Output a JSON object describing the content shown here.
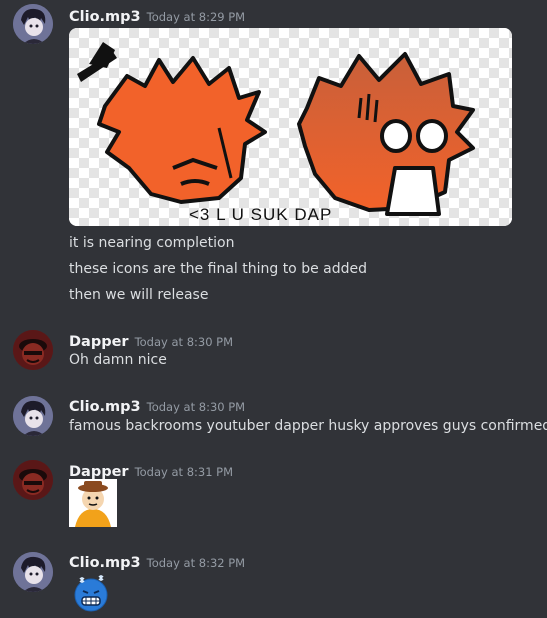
{
  "messages": [
    {
      "author": "Clio.mp3",
      "timestamp": "Today at 8:29 PM",
      "attachment": {
        "caption": "<3 L U SUK DAP"
      },
      "lines": [
        "it is nearing completion",
        "these icons are the final thing to be added",
        "then we will release"
      ]
    },
    {
      "author": "Dapper",
      "timestamp": "Today at 8:30 PM",
      "lines": [
        "Oh damn nice"
      ]
    },
    {
      "author": "Clio.mp3",
      "timestamp": "Today at 8:30 PM",
      "lines": [
        "famous backrooms youtuber dapper husky approves guys confirmed"
      ]
    },
    {
      "author": "Dapper",
      "timestamp": "Today at 8:31 PM",
      "sticker": "cartoon-character-sticker"
    },
    {
      "author": "Clio.mp3",
      "timestamp": "Today at 8:32 PM",
      "emoji": "cold-face-emoji"
    }
  ],
  "colors": {
    "background": "#313338",
    "username": "#f2f3f5",
    "text": "#dbdee1",
    "timestamp": "#949ba4",
    "orange": "#f2622a"
  }
}
